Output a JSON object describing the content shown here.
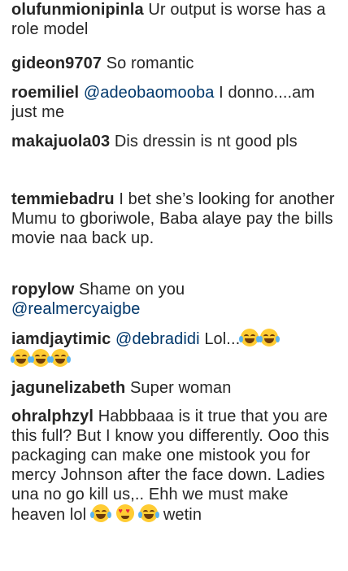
{
  "comments": [
    {
      "user": "olufunmionipinla",
      "text": "Ur output is worse has a role model"
    },
    {
      "user": "gideon9707",
      "text": "So romantic"
    },
    {
      "user": "roemiliel",
      "mention": "@adeobaomooba",
      "text": "I donno....am just me"
    },
    {
      "user": "makajuola03",
      "text": "Dis dressin is nt good pls"
    },
    {
      "user": "temmiebadru",
      "text": "I bet she’s looking for another Mumu to gboriwole, Baba alaye pay the bills movie naa back up."
    },
    {
      "user": "ropylow",
      "text": "Shame on you",
      "mention": "@realmercyaigbe"
    },
    {
      "user": "iamdjaytimic",
      "mention": "@debradidi",
      "text": "Lol..."
    },
    {
      "user": "jagunelizabeth",
      "text": "Super woman"
    },
    {
      "user": "ohralphzyl",
      "text": "Habbbaaa is it true that you are this full? But I know you differently. Ooo this packaging can make one mistook you for mercy Johnson after the face down. Ladies una no go kill us,.. Ehh we must make heaven lol",
      "trailing_text": "wetin"
    }
  ],
  "emoji_names": {
    "laugh": "face-with-tears-of-joy",
    "hearts": "smiling-face-with-heart-eyes"
  },
  "colors": {
    "text": "#262626",
    "mention": "#00376b",
    "background": "#ffffff"
  }
}
